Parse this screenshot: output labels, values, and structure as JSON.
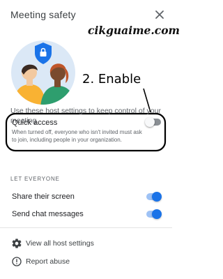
{
  "panel": {
    "title": "Meeting safety",
    "close_icon": "close-icon"
  },
  "watermark": "cikguaime.com",
  "annotation": {
    "text": "2. Enable"
  },
  "description": "Use these host settings to keep control of your meeting",
  "quick_access": {
    "label": "Quick access",
    "help": "When turned off, everyone who isn't invited must ask to join, including people in your organization.",
    "enabled": false
  },
  "let_everyone": {
    "section_label": "LET EVERYONE",
    "items": [
      {
        "label": "Share their screen",
        "enabled": true
      },
      {
        "label": "Send chat messages",
        "enabled": true
      }
    ]
  },
  "footer_menu": [
    {
      "label": "View all host settings",
      "icon": "gear-icon"
    },
    {
      "label": "Report abuse",
      "icon": "alert-icon"
    }
  ],
  "colors": {
    "accent": "#1a73e8",
    "accent_track": "#9ec2f5",
    "illustration_bg": "#dbe8f6",
    "shield": "#1a73e8",
    "person_left_shirt": "#f9b233",
    "person_right_shirt": "#2e9e6e"
  }
}
